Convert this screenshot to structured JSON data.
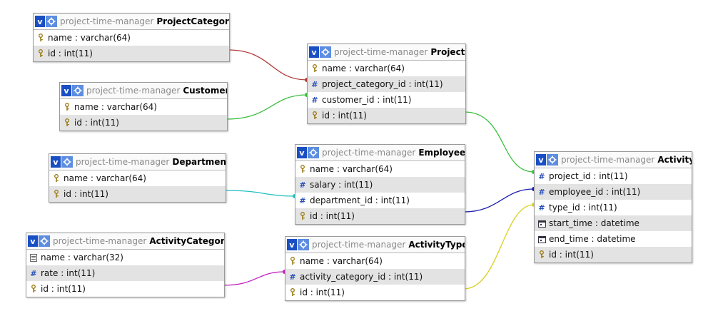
{
  "colors": {
    "category_project": "#b33b3b",
    "customer_project": "#3fbf3f",
    "project_activity": "#3fbf3f",
    "employee_activity": "#2020b0",
    "department_employee": "#20c0c0",
    "activitycategory_activitytype": "#c020c0",
    "activitytype_activity": "#d8d020"
  },
  "tables": [
    {
      "key": "projectcategory",
      "db": "project-time-manager",
      "name": "ProjectCategory",
      "columns": [
        {
          "text": "name : varchar(64)",
          "icon": "key-icon"
        },
        {
          "text": "id : int(11)",
          "icon": "key-icon"
        }
      ]
    },
    {
      "key": "project",
      "db": "project-time-manager",
      "name": "Project",
      "columns": [
        {
          "text": "name : varchar(64)",
          "icon": "key-icon"
        },
        {
          "text": "project_category_id : int(11)",
          "icon": "hash-icon"
        },
        {
          "text": "customer_id : int(11)",
          "icon": "hash-icon"
        },
        {
          "text": "id : int(11)",
          "icon": "key-icon"
        }
      ]
    },
    {
      "key": "customer",
      "db": "project-time-manager",
      "name": "Customer",
      "columns": [
        {
          "text": "name : varchar(64)",
          "icon": "key-icon"
        },
        {
          "text": "id : int(11)",
          "icon": "key-icon"
        }
      ]
    },
    {
      "key": "department",
      "db": "project-time-manager",
      "name": "Department",
      "columns": [
        {
          "text": "name : varchar(64)",
          "icon": "key-icon"
        },
        {
          "text": "id : int(11)",
          "icon": "key-icon"
        }
      ]
    },
    {
      "key": "employee",
      "db": "project-time-manager",
      "name": "Employee",
      "columns": [
        {
          "text": "name : varchar(64)",
          "icon": "key-icon"
        },
        {
          "text": "salary : int(11)",
          "icon": "hash-icon"
        },
        {
          "text": "department_id : int(11)",
          "icon": "hash-icon"
        },
        {
          "text": "id : int(11)",
          "icon": "key-icon"
        }
      ]
    },
    {
      "key": "activity",
      "db": "project-time-manager",
      "name": "Activity",
      "columns": [
        {
          "text": "project_id : int(11)",
          "icon": "hash-icon"
        },
        {
          "text": "employee_id : int(11)",
          "icon": "hash-icon"
        },
        {
          "text": "type_id : int(11)",
          "icon": "hash-icon"
        },
        {
          "text": "start_time : datetime",
          "icon": "calendar-icon"
        },
        {
          "text": "end_time : datetime",
          "icon": "calendar-icon"
        },
        {
          "text": "id : int(11)",
          "icon": "key-icon"
        }
      ]
    },
    {
      "key": "activitycategory",
      "db": "project-time-manager",
      "name": "ActivityCategory",
      "columns": [
        {
          "text": "name : varchar(32)",
          "icon": "text-icon"
        },
        {
          "text": "rate : int(11)",
          "icon": "hash-icon"
        },
        {
          "text": "id : int(11)",
          "icon": "key-icon"
        }
      ]
    },
    {
      "key": "activitytype",
      "db": "project-time-manager",
      "name": "ActivityType",
      "columns": [
        {
          "text": "name : varchar(64)",
          "icon": "key-icon"
        },
        {
          "text": "activity_category_id : int(11)",
          "icon": "hash-icon"
        },
        {
          "text": "id : int(11)",
          "icon": "key-icon"
        }
      ]
    }
  ]
}
